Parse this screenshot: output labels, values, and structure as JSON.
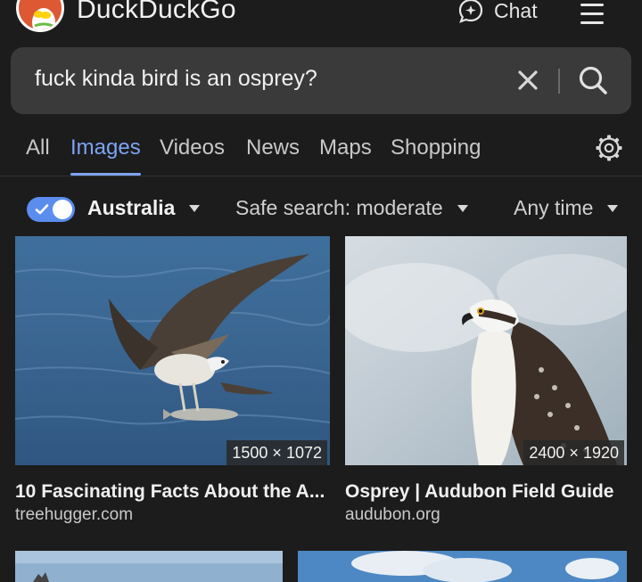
{
  "header": {
    "brand": "DuckDuckGo",
    "chat_label": "Chat",
    "icons": [
      "duckduckgo-logo",
      "chat-icon",
      "menu-icon"
    ]
  },
  "search": {
    "query": "fuck kinda bird is an osprey?",
    "icons": [
      "close-icon",
      "search-icon"
    ]
  },
  "tabs": [
    {
      "label": "All",
      "active": false
    },
    {
      "label": "Images",
      "active": true
    },
    {
      "label": "Videos",
      "active": false
    },
    {
      "label": "News",
      "active": false
    },
    {
      "label": "Maps",
      "active": false
    },
    {
      "label": "Shopping",
      "active": false
    }
  ],
  "filters": {
    "region_enabled": true,
    "region": "Australia",
    "safe_search": "Safe search: moderate",
    "time": "Any time"
  },
  "results": [
    {
      "title": "10 Fascinating Facts About the A...",
      "source": "treehugger.com",
      "dimensions": "1500 × 1072"
    },
    {
      "title": "Osprey | Audubon Field Guide",
      "source": "audubon.org",
      "dimensions": "2400 × 1920"
    }
  ],
  "colors": {
    "background": "#1c1c1c",
    "accent": "#7da4f4",
    "toggle": "#5b8def",
    "search_box": "#3a3a3a",
    "logo": "#de5833"
  }
}
